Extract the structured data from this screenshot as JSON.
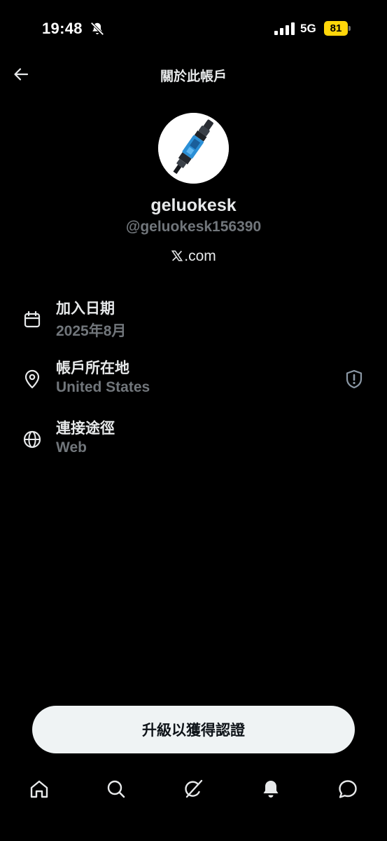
{
  "status_bar": {
    "time": "19:48",
    "network": "5G",
    "battery": "81"
  },
  "header": {
    "title": "關於此帳戶"
  },
  "profile": {
    "display_name": "geluokesk",
    "username": "@geluokesk156390",
    "link_text": ".com"
  },
  "details": [
    {
      "label": "加入日期",
      "value": "2025年8月",
      "icon": "calendar-icon"
    },
    {
      "label": "帳戶所在地",
      "value": "United States",
      "icon": "location-pin-icon"
    },
    {
      "label": "連接途徑",
      "value": "Web",
      "icon": "globe-icon"
    }
  ],
  "upgrade": {
    "label": "升級以獲得認證"
  },
  "nav": [
    "home-icon",
    "search-icon",
    "grok-icon",
    "notifications-icon",
    "messages-icon"
  ],
  "colors": {
    "background": "#000000",
    "primary_text": "#e7e9ea",
    "secondary_text": "#71767b",
    "button_bg": "#eff3f4",
    "battery": "#ffd60a"
  }
}
